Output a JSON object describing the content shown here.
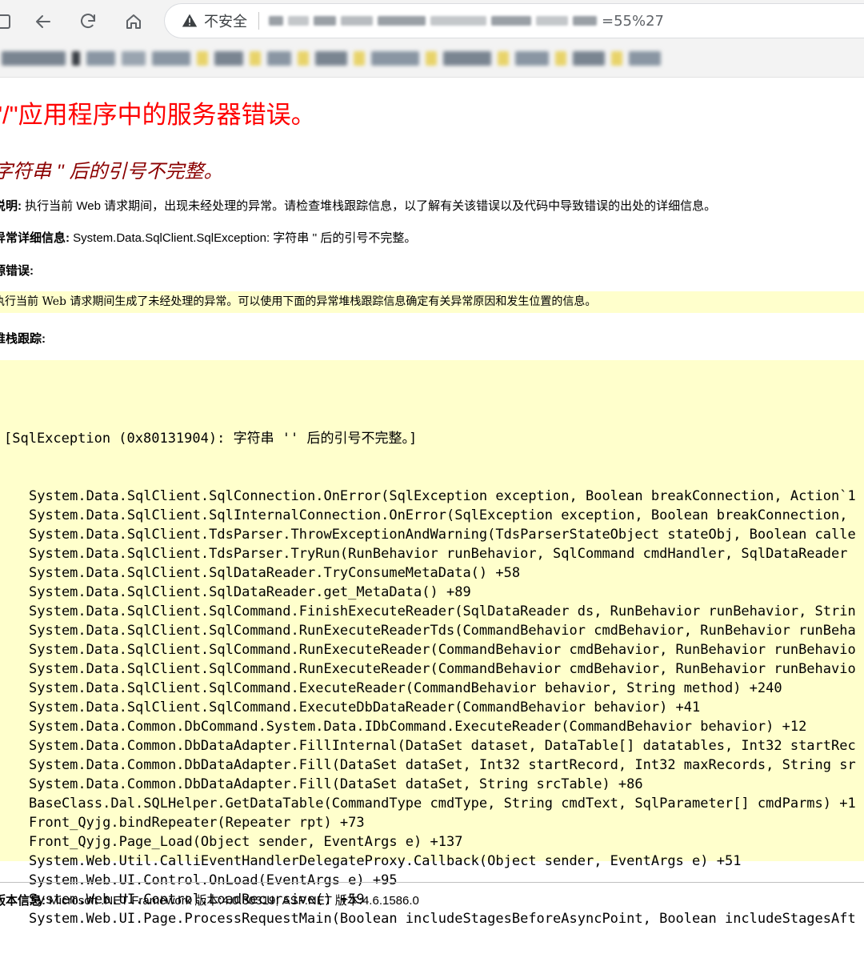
{
  "browser": {
    "security_label": "不安全",
    "url_tail": "=55%27"
  },
  "page": {
    "title": "\"/\"应用程序中的服务器错误。",
    "subtitle": "字符串 '' 后的引号不完整。",
    "description_label": "说明:",
    "description_text": " 执行当前 Web 请求期间，出现未经处理的异常。请检查堆栈跟踪信息，以了解有关该错误以及代码中导致错误的出处的详细信息。",
    "exception_label": "异常详细信息:",
    "exception_text": " System.Data.SqlClient.SqlException: 字符串 '' 后的引号不完整。",
    "source_label": "源错误:",
    "source_text": "执行当前 Web 请求期间生成了未经处理的异常。可以使用下面的异常堆栈跟踪信息确定有关异常原因和发生位置的信息。",
    "stack_label": "堆栈跟踪:",
    "stack_header": "[SqlException (0x80131904): 字符串 '' 后的引号不完整。]",
    "stack_lines": [
      "System.Data.SqlClient.SqlConnection.OnError(SqlException exception, Boolean breakConnection, Action`1",
      "System.Data.SqlClient.SqlInternalConnection.OnError(SqlException exception, Boolean breakConnection,",
      "System.Data.SqlClient.TdsParser.ThrowExceptionAndWarning(TdsParserStateObject stateObj, Boolean calle",
      "System.Data.SqlClient.TdsParser.TryRun(RunBehavior runBehavior, SqlCommand cmdHandler, SqlDataReader",
      "System.Data.SqlClient.SqlDataReader.TryConsumeMetaData() +58",
      "System.Data.SqlClient.SqlDataReader.get_MetaData() +89",
      "System.Data.SqlClient.SqlCommand.FinishExecuteReader(SqlDataReader ds, RunBehavior runBehavior, Strin",
      "System.Data.SqlClient.SqlCommand.RunExecuteReaderTds(CommandBehavior cmdBehavior, RunBehavior runBeha",
      "System.Data.SqlClient.SqlCommand.RunExecuteReader(CommandBehavior cmdBehavior, RunBehavior runBehavio",
      "System.Data.SqlClient.SqlCommand.RunExecuteReader(CommandBehavior cmdBehavior, RunBehavior runBehavio",
      "System.Data.SqlClient.SqlCommand.ExecuteReader(CommandBehavior behavior, String method) +240",
      "System.Data.SqlClient.SqlCommand.ExecuteDbDataReader(CommandBehavior behavior) +41",
      "System.Data.Common.DbCommand.System.Data.IDbCommand.ExecuteReader(CommandBehavior behavior) +12",
      "System.Data.Common.DbDataAdapter.FillInternal(DataSet dataset, DataTable[] datatables, Int32 startRec",
      "System.Data.Common.DbDataAdapter.Fill(DataSet dataSet, Int32 startRecord, Int32 maxRecords, String sr",
      "System.Data.Common.DbDataAdapter.Fill(DataSet dataSet, String srcTable) +86",
      "BaseClass.Dal.SQLHelper.GetDataTable(CommandType cmdType, String cmdText, SqlParameter[] cmdParms) +1",
      "Front_Qyjg.bindRepeater(Repeater rpt) +73",
      "Front_Qyjg.Page_Load(Object sender, EventArgs e) +137",
      "System.Web.Util.CalliEventHandlerDelegateProxy.Callback(Object sender, EventArgs e) +51",
      "System.Web.UI.Control.OnLoad(EventArgs e) +95",
      "System.Web.UI.Control.LoadRecursive() +59",
      "System.Web.UI.Page.ProcessRequestMain(Boolean includeStagesBeforeAsyncPoint, Boolean includeStagesAft"
    ],
    "version_label": "版本信息:",
    "version_text": " Microsoft .NET Framework 版本:4.0.30319; ASP.NET 版本:4.6.1586.0"
  }
}
